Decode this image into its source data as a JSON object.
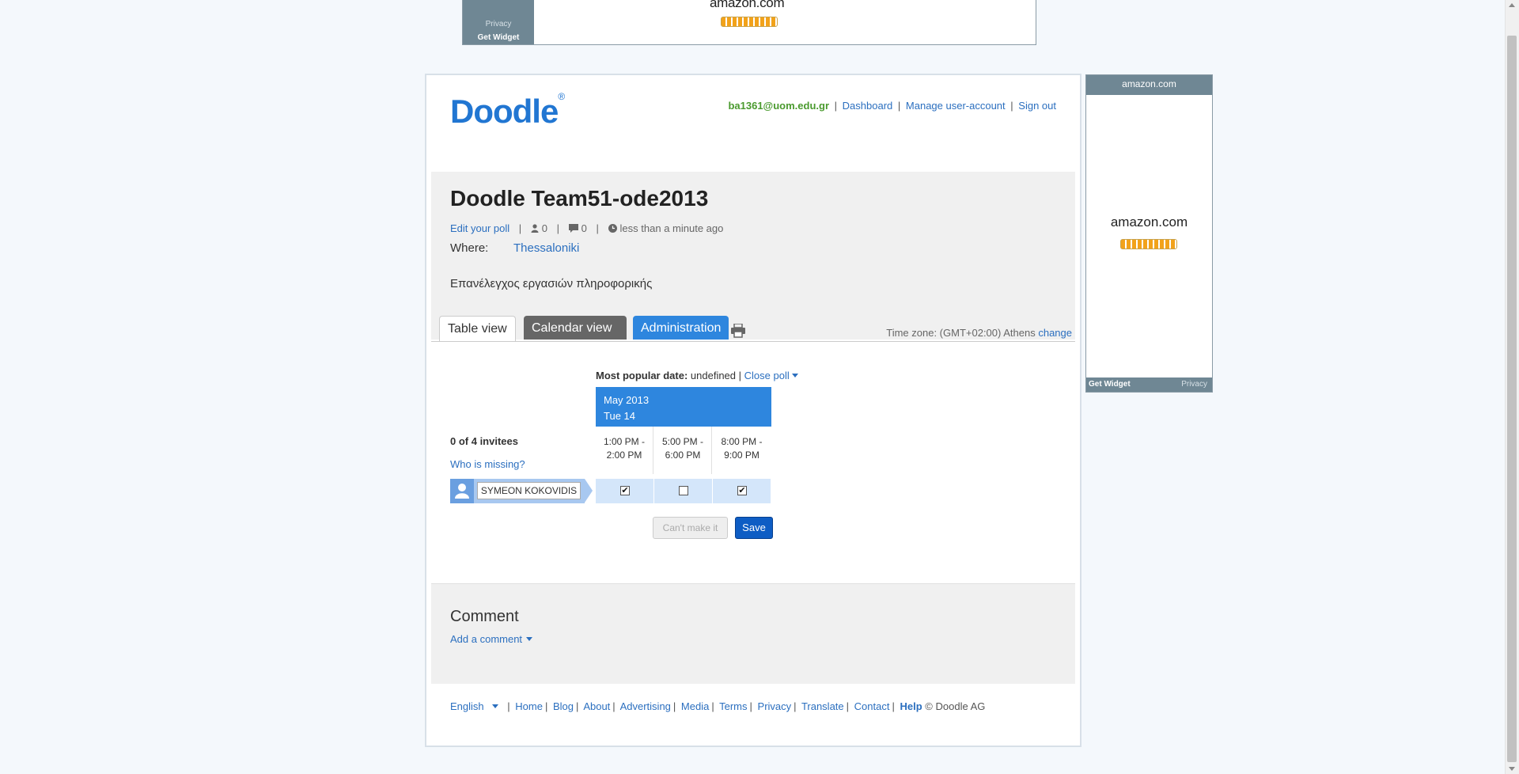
{
  "top_ad": {
    "privacy": "Privacy",
    "get_widget": "Get Widget",
    "logo": "amazon.com"
  },
  "header": {
    "logo": "Doodle",
    "logo_mark": "®",
    "user_email": "ba1361@uom.edu.gr",
    "nav": [
      "Dashboard",
      "Manage user-account",
      "Sign out"
    ]
  },
  "poll": {
    "title": "Doodle Team51-ode2013",
    "edit_link": "Edit your poll",
    "participants_count": "0",
    "comments_count": "0",
    "created": "less than a minute ago",
    "where_label": "Where:",
    "where_value": "Thessaloniki",
    "description": "Επανέλεγχος εργασιών πληροφορικής"
  },
  "tabs": {
    "table_view": "Table view",
    "calendar_view": "Calendar view",
    "administration": "Administration"
  },
  "timezone": {
    "label": "Time zone: (GMT+02:00) Athens",
    "change": "change"
  },
  "grid": {
    "popular_label": "Most popular date:",
    "popular_value": "undefined",
    "close_poll": "Close poll",
    "month": "May 2013",
    "day": "Tue 14",
    "slots": [
      {
        "line1": "1:00 PM -",
        "line2": "2:00 PM"
      },
      {
        "line1": "5:00 PM -",
        "line2": "6:00 PM"
      },
      {
        "line1": "8:00 PM -",
        "line2": "9:00 PM"
      }
    ],
    "invitees": "0 of 4 invitees",
    "who_missing": "Who is missing?",
    "participant_name": "SYMEON KOKOVIDIS",
    "checks": [
      true,
      false,
      true
    ],
    "cant_make_it": "Can't make it",
    "save": "Save"
  },
  "comment": {
    "title": "Comment",
    "add": "Add a comment"
  },
  "footer": {
    "language": "English",
    "links": [
      "Home",
      "Blog",
      "About",
      "Advertising",
      "Media",
      "Terms",
      "Privacy",
      "Translate",
      "Contact"
    ],
    "help": "Help",
    "copyright": "© Doodle AG"
  },
  "right_ad": {
    "top_logo": "amazon.com",
    "logo": "amazon.com",
    "get_widget": "Get Widget",
    "privacy": "Privacy"
  },
  "colors": {
    "brand_blue": "#2176d2",
    "link": "#2b6fbf",
    "email_green": "#4a9a2e",
    "save_button": "#0e5dc4"
  }
}
